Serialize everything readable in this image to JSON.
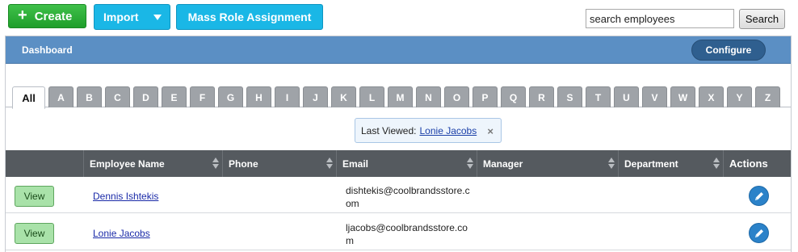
{
  "toolbar": {
    "create_label": "Create",
    "create_icon": "plus",
    "import_label": "Import",
    "mass_role_label": "Mass Role Assignment",
    "search_value": "search employees",
    "search_button_label": "Search"
  },
  "panel": {
    "title": "Dashboard",
    "configure_label": "Configure"
  },
  "tabs": [
    "All",
    "A",
    "B",
    "C",
    "D",
    "E",
    "F",
    "G",
    "H",
    "I",
    "J",
    "K",
    "L",
    "M",
    "N",
    "O",
    "P",
    "Q",
    "R",
    "S",
    "T",
    "U",
    "V",
    "W",
    "X",
    "Y",
    "Z"
  ],
  "active_tab": "All",
  "last_viewed": {
    "label": "Last Viewed:",
    "name": "Lonie Jacobs",
    "close_icon": "×"
  },
  "table": {
    "columns": [
      "",
      "Employee Name",
      "Phone",
      "Email",
      "Manager",
      "Department",
      "Actions"
    ],
    "rows": [
      {
        "view_label": "View",
        "name": "Dennis Ishtekis",
        "phone": "",
        "email": "dishtekis@coolbrandsstore.com",
        "manager": "",
        "department": ""
      },
      {
        "view_label": "View",
        "name": "Lonie Jacobs",
        "phone": "",
        "email": "ljacobs@coolbrandsstore.com",
        "manager": "",
        "department": ""
      }
    ]
  },
  "colors": {
    "create_green": "#22a12e",
    "accent_blue": "#1ab7e6",
    "header_blue": "#5b8fc4",
    "table_header": "#555a5f"
  }
}
